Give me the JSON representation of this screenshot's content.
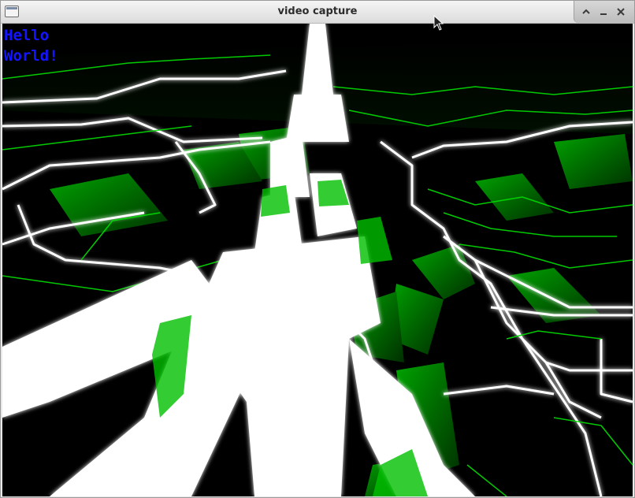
{
  "window": {
    "title": "video capture"
  },
  "controls": {
    "maximize_icon": "maximize-icon",
    "minimize_icon": "minimize-icon",
    "close_icon": "close-icon"
  },
  "canvas": {
    "overlay_line1": "Hello",
    "overlay_line2": "World!"
  },
  "colors": {
    "neon_green": "#00d000",
    "glow_white": "#ffffff",
    "overlay_text": "#1414ff",
    "background": "#000000"
  }
}
